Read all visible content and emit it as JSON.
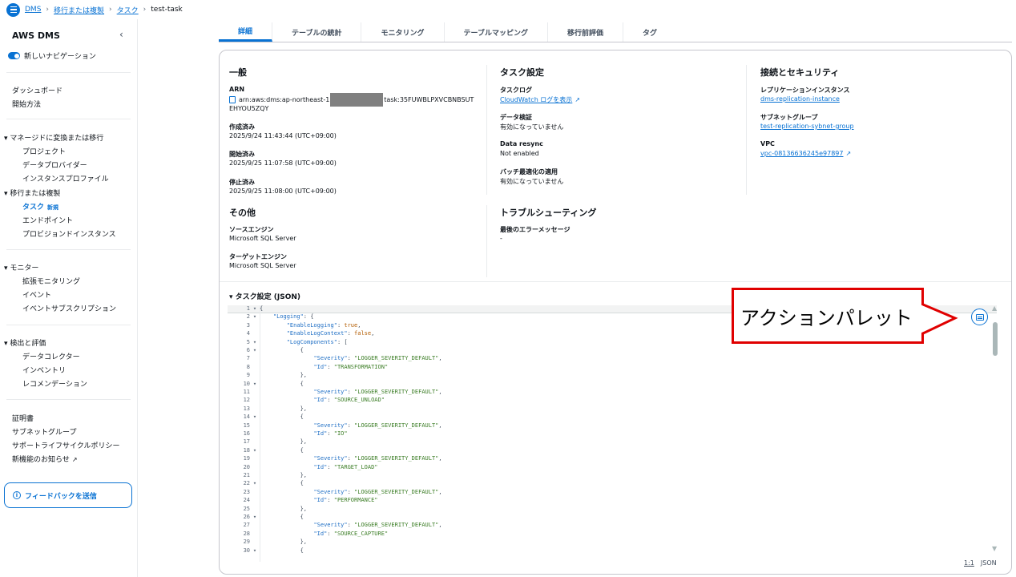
{
  "breadcrumb": {
    "items": [
      "DMS",
      "移行または複製",
      "タスク"
    ],
    "current": "test-task"
  },
  "sidebar": {
    "title": "AWS DMS",
    "new_nav_label": "新しいナビゲーション",
    "top_items": [
      "ダッシュボード",
      "開始方法"
    ],
    "group_managed": {
      "label": "マネージドに変換または移行",
      "items": [
        "プロジェクト",
        "データプロバイダー",
        "インスタンスプロファイル"
      ]
    },
    "group_migrate": {
      "label": "移行または複製",
      "items": [
        "タスク",
        "エンドポイント",
        "プロビジョンドインスタンス"
      ],
      "new_badge": "新規"
    },
    "group_monitor": {
      "label": "モニター",
      "items": [
        "拡張モニタリング",
        "イベント",
        "イベントサブスクリプション"
      ]
    },
    "group_discover": {
      "label": "検出と評価",
      "items": [
        "データコレクター",
        "インベントリ",
        "レコメンデーション"
      ]
    },
    "bottom_items": [
      "証明書",
      "サブネットグループ",
      "サポートライフサイクルポリシー",
      "新機能のお知らせ"
    ],
    "feedback_label": "フィードバックを送信"
  },
  "tabs": [
    "詳細",
    "テーブルの統計",
    "モニタリング",
    "テーブルマッピング",
    "移行前評価",
    "タグ"
  ],
  "general": {
    "title": "一般",
    "arn_label": "ARN",
    "arn_prefix": "arn:aws:dms:ap-northeast-1",
    "arn_suffix": "task:35FUWBLPXVCBNBSUT",
    "arn_line2": "EHYOU5ZQY",
    "created_label": "作成済み",
    "created_value": "2025/9/24 11:43:44 (UTC+09:00)",
    "started_label": "開始済み",
    "started_value": "2025/9/25 11:07:58 (UTC+09:00)",
    "stopped_label": "停止済み",
    "stopped_value": "2025/9/25 11:08:00 (UTC+09:00)"
  },
  "task_settings": {
    "title": "タスク設定",
    "log_label": "タスクログ",
    "log_link": "CloudWatch ログを表示",
    "validation_label": "データ検証",
    "validation_value": "有効になっていません",
    "resync_label": "Data resync",
    "resync_value": "Not enabled",
    "batch_label": "バッチ最適化の適用",
    "batch_value": "有効になっていません"
  },
  "connection": {
    "title": "接続とセキュリティ",
    "instance_label": "レプリケーションインスタンス",
    "instance_link": "dms-replication-instance",
    "subnet_label": "サブネットグループ",
    "subnet_link": "test-replication-sybnet-group",
    "vpc_label": "VPC",
    "vpc_link": "vpc-08136636245e97897"
  },
  "other": {
    "title": "その他",
    "source_label": "ソースエンジン",
    "source_value": "Microsoft SQL Server",
    "target_label": "ターゲットエンジン",
    "target_value": "Microsoft SQL Server"
  },
  "troubleshoot": {
    "title": "トラブルシューティング",
    "last_error_label": "最後のエラーメッセージ",
    "last_error_value": "-"
  },
  "json_section": {
    "title": "タスク設定 (JSON)"
  },
  "code_lines": [
    {
      "n": "1",
      "fold": true,
      "text": "{"
    },
    {
      "n": "2",
      "fold": true,
      "text": "    \"Logging\": {"
    },
    {
      "n": "3",
      "fold": false,
      "text": "        \"EnableLogging\": true,"
    },
    {
      "n": "4",
      "fold": false,
      "text": "        \"EnableLogContext\": false,"
    },
    {
      "n": "5",
      "fold": true,
      "text": "        \"LogComponents\": ["
    },
    {
      "n": "6",
      "fold": true,
      "text": "            {"
    },
    {
      "n": "7",
      "fold": false,
      "text": "                \"Severity\": \"LOGGER_SEVERITY_DEFAULT\","
    },
    {
      "n": "8",
      "fold": false,
      "text": "                \"Id\": \"TRANSFORMATION\""
    },
    {
      "n": "9",
      "fold": false,
      "text": "            },"
    },
    {
      "n": "10",
      "fold": true,
      "text": "            {"
    },
    {
      "n": "11",
      "fold": false,
      "text": "                \"Severity\": \"LOGGER_SEVERITY_DEFAULT\","
    },
    {
      "n": "12",
      "fold": false,
      "text": "                \"Id\": \"SOURCE_UNLOAD\""
    },
    {
      "n": "13",
      "fold": false,
      "text": "            },"
    },
    {
      "n": "14",
      "fold": true,
      "text": "            {"
    },
    {
      "n": "15",
      "fold": false,
      "text": "                \"Severity\": \"LOGGER_SEVERITY_DEFAULT\","
    },
    {
      "n": "16",
      "fold": false,
      "text": "                \"Id\": \"IO\""
    },
    {
      "n": "17",
      "fold": false,
      "text": "            },"
    },
    {
      "n": "18",
      "fold": true,
      "text": "            {"
    },
    {
      "n": "19",
      "fold": false,
      "text": "                \"Severity\": \"LOGGER_SEVERITY_DEFAULT\","
    },
    {
      "n": "20",
      "fold": false,
      "text": "                \"Id\": \"TARGET_LOAD\""
    },
    {
      "n": "21",
      "fold": false,
      "text": "            },"
    },
    {
      "n": "22",
      "fold": true,
      "text": "            {"
    },
    {
      "n": "23",
      "fold": false,
      "text": "                \"Severity\": \"LOGGER_SEVERITY_DEFAULT\","
    },
    {
      "n": "24",
      "fold": false,
      "text": "                \"Id\": \"PERFORMANCE\""
    },
    {
      "n": "25",
      "fold": false,
      "text": "            },"
    },
    {
      "n": "26",
      "fold": true,
      "text": "            {"
    },
    {
      "n": "27",
      "fold": false,
      "text": "                \"Severity\": \"LOGGER_SEVERITY_DEFAULT\","
    },
    {
      "n": "28",
      "fold": false,
      "text": "                \"Id\": \"SOURCE_CAPTURE\""
    },
    {
      "n": "29",
      "fold": false,
      "text": "            },"
    },
    {
      "n": "30",
      "fold": true,
      "text": "            {"
    }
  ],
  "status_bar": {
    "position": "1:1",
    "mode": "JSON"
  },
  "callout": {
    "text": "アクションパレット"
  },
  "icons": {
    "menu": "hamburger-menu-icon",
    "external": "external-link-icon",
    "copy": "copy-icon",
    "palette": "action-palette-icon",
    "info": "info-icon"
  },
  "colors": {
    "accent": "#0972d3",
    "callout": "#e00000"
  }
}
